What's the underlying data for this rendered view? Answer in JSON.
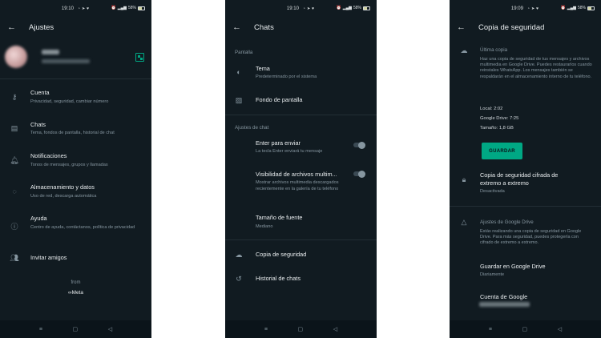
{
  "screen1": {
    "status_time": "19:10",
    "battery": "58%",
    "title": "Ajustes",
    "items": [
      {
        "icon": "key-icon",
        "label": "Cuenta",
        "sub": "Privacidad, seguridad, cambiar número"
      },
      {
        "icon": "chat-icon",
        "label": "Chats",
        "sub": "Tema, fondos de pantalla, historial de chat"
      },
      {
        "icon": "bell-icon",
        "label": "Notificaciones",
        "sub": "Tonos de mensajes, grupos y llamadas"
      },
      {
        "icon": "data-usage-icon",
        "label": "Almacenamiento y datos",
        "sub": "Uso de red, descarga automática"
      },
      {
        "icon": "help-icon",
        "label": "Ayuda",
        "sub": "Centro de ayuda, contáctanos, política de privacidad"
      },
      {
        "icon": "people-icon",
        "label": "Invitar amigos",
        "sub": ""
      }
    ],
    "from": "from",
    "meta": "∞Meta"
  },
  "screen2": {
    "status_time": "19:10",
    "battery": "58%",
    "title": "Chats",
    "section_display": "Pantalla",
    "theme_label": "Tema",
    "theme_sub": "Predeterminado por el sistema",
    "wallpaper_label": "Fondo de pantalla",
    "section_chat": "Ajustes de chat",
    "enter_label": "Enter para enviar",
    "enter_sub": "La tecla Enter enviará tu mensaje",
    "enter_on": false,
    "media_label": "Visibilidad de archivos multim...",
    "media_sub": "Mostrar archivos multimedia descargados recientemente en la galería de tu teléfono",
    "media_on": false,
    "font_label": "Tamaño de fuente",
    "font_sub": "Mediano",
    "backup_label": "Copia de seguridad",
    "history_label": "Historial de chats"
  },
  "screen3": {
    "status_time": "19:09",
    "battery": "58%",
    "title": "Copia de seguridad",
    "last_backup_title": "Última copia",
    "last_backup_desc": "Haz una copia de seguridad de tus mensajes y archivos multimedia en Google Drive. Puedes restaurarlos cuando reinstales WhatsApp. Los mensajes también se respaldarán en el almacenamiento interno de tu teléfono.",
    "local": "Local: 2:02",
    "gdrive": "Google Drive: 7:25",
    "size": "Tamaño: 1,8 GB",
    "save_button": "GUARDAR",
    "e2e_label": "Copia de seguridad cifrada de extremo a extremo",
    "e2e_sub": "Desactivada",
    "gdrive_section": "Ajustes de Google Drive",
    "gdrive_desc": "Estás realizando una copia de seguridad en Google Drive. Para más seguridad, puedes protegerla con cifrado de extremo a extremo.",
    "save_gdrive_label": "Guardar en Google Drive",
    "save_gdrive_sub": "Diariamente",
    "account_label": "Cuenta de Google"
  },
  "navbar": {
    "menu": "≡",
    "home": "▢",
    "back": "◁"
  }
}
